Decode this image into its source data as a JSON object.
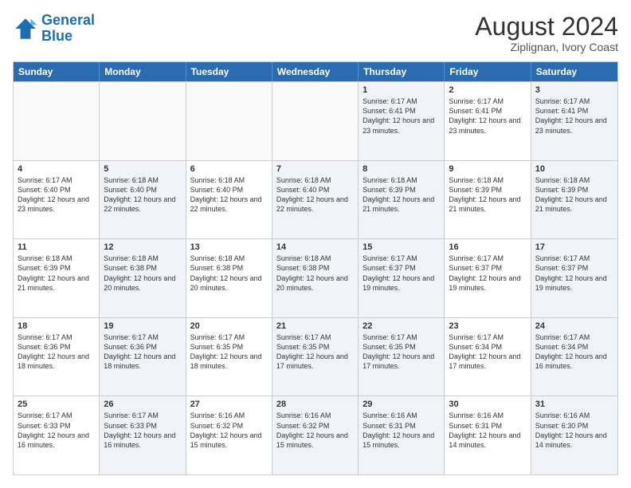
{
  "header": {
    "logo_line1": "General",
    "logo_line2": "Blue",
    "main_title": "August 2024",
    "subtitle": "Ziplignan, Ivory Coast"
  },
  "days_of_week": [
    "Sunday",
    "Monday",
    "Tuesday",
    "Wednesday",
    "Thursday",
    "Friday",
    "Saturday"
  ],
  "rows": [
    [
      {
        "num": "",
        "info": "",
        "empty": true
      },
      {
        "num": "",
        "info": "",
        "empty": true
      },
      {
        "num": "",
        "info": "",
        "empty": true
      },
      {
        "num": "",
        "info": "",
        "empty": true
      },
      {
        "num": "1",
        "info": "Sunrise: 6:17 AM\nSunset: 6:41 PM\nDaylight: 12 hours\nand 23 minutes.",
        "shaded": true
      },
      {
        "num": "2",
        "info": "Sunrise: 6:17 AM\nSunset: 6:41 PM\nDaylight: 12 hours\nand 23 minutes."
      },
      {
        "num": "3",
        "info": "Sunrise: 6:17 AM\nSunset: 6:41 PM\nDaylight: 12 hours\nand 23 minutes.",
        "shaded": true
      }
    ],
    [
      {
        "num": "4",
        "info": "Sunrise: 6:17 AM\nSunset: 6:40 PM\nDaylight: 12 hours\nand 23 minutes."
      },
      {
        "num": "5",
        "info": "Sunrise: 6:18 AM\nSunset: 6:40 PM\nDaylight: 12 hours\nand 22 minutes.",
        "shaded": true
      },
      {
        "num": "6",
        "info": "Sunrise: 6:18 AM\nSunset: 6:40 PM\nDaylight: 12 hours\nand 22 minutes."
      },
      {
        "num": "7",
        "info": "Sunrise: 6:18 AM\nSunset: 6:40 PM\nDaylight: 12 hours\nand 22 minutes.",
        "shaded": true
      },
      {
        "num": "8",
        "info": "Sunrise: 6:18 AM\nSunset: 6:39 PM\nDaylight: 12 hours\nand 21 minutes.",
        "shaded": true
      },
      {
        "num": "9",
        "info": "Sunrise: 6:18 AM\nSunset: 6:39 PM\nDaylight: 12 hours\nand 21 minutes."
      },
      {
        "num": "10",
        "info": "Sunrise: 6:18 AM\nSunset: 6:39 PM\nDaylight: 12 hours\nand 21 minutes.",
        "shaded": true
      }
    ],
    [
      {
        "num": "11",
        "info": "Sunrise: 6:18 AM\nSunset: 6:39 PM\nDaylight: 12 hours\nand 21 minutes."
      },
      {
        "num": "12",
        "info": "Sunrise: 6:18 AM\nSunset: 6:38 PM\nDaylight: 12 hours\nand 20 minutes.",
        "shaded": true
      },
      {
        "num": "13",
        "info": "Sunrise: 6:18 AM\nSunset: 6:38 PM\nDaylight: 12 hours\nand 20 minutes."
      },
      {
        "num": "14",
        "info": "Sunrise: 6:18 AM\nSunset: 6:38 PM\nDaylight: 12 hours\nand 20 minutes.",
        "shaded": true
      },
      {
        "num": "15",
        "info": "Sunrise: 6:17 AM\nSunset: 6:37 PM\nDaylight: 12 hours\nand 19 minutes.",
        "shaded": true
      },
      {
        "num": "16",
        "info": "Sunrise: 6:17 AM\nSunset: 6:37 PM\nDaylight: 12 hours\nand 19 minutes."
      },
      {
        "num": "17",
        "info": "Sunrise: 6:17 AM\nSunset: 6:37 PM\nDaylight: 12 hours\nand 19 minutes.",
        "shaded": true
      }
    ],
    [
      {
        "num": "18",
        "info": "Sunrise: 6:17 AM\nSunset: 6:36 PM\nDaylight: 12 hours\nand 18 minutes."
      },
      {
        "num": "19",
        "info": "Sunrise: 6:17 AM\nSunset: 6:36 PM\nDaylight: 12 hours\nand 18 minutes.",
        "shaded": true
      },
      {
        "num": "20",
        "info": "Sunrise: 6:17 AM\nSunset: 6:35 PM\nDaylight: 12 hours\nand 18 minutes."
      },
      {
        "num": "21",
        "info": "Sunrise: 6:17 AM\nSunset: 6:35 PM\nDaylight: 12 hours\nand 17 minutes.",
        "shaded": true
      },
      {
        "num": "22",
        "info": "Sunrise: 6:17 AM\nSunset: 6:35 PM\nDaylight: 12 hours\nand 17 minutes.",
        "shaded": true
      },
      {
        "num": "23",
        "info": "Sunrise: 6:17 AM\nSunset: 6:34 PM\nDaylight: 12 hours\nand 17 minutes."
      },
      {
        "num": "24",
        "info": "Sunrise: 6:17 AM\nSunset: 6:34 PM\nDaylight: 12 hours\nand 16 minutes.",
        "shaded": true
      }
    ],
    [
      {
        "num": "25",
        "info": "Sunrise: 6:17 AM\nSunset: 6:33 PM\nDaylight: 12 hours\nand 16 minutes."
      },
      {
        "num": "26",
        "info": "Sunrise: 6:17 AM\nSunset: 6:33 PM\nDaylight: 12 hours\nand 16 minutes.",
        "shaded": true
      },
      {
        "num": "27",
        "info": "Sunrise: 6:16 AM\nSunset: 6:32 PM\nDaylight: 12 hours\nand 15 minutes."
      },
      {
        "num": "28",
        "info": "Sunrise: 6:16 AM\nSunset: 6:32 PM\nDaylight: 12 hours\nand 15 minutes.",
        "shaded": true
      },
      {
        "num": "29",
        "info": "Sunrise: 6:16 AM\nSunset: 6:31 PM\nDaylight: 12 hours\nand 15 minutes.",
        "shaded": true
      },
      {
        "num": "30",
        "info": "Sunrise: 6:16 AM\nSunset: 6:31 PM\nDaylight: 12 hours\nand 14 minutes."
      },
      {
        "num": "31",
        "info": "Sunrise: 6:16 AM\nSunset: 6:30 PM\nDaylight: 12 hours\nand 14 minutes.",
        "shaded": true
      }
    ]
  ]
}
